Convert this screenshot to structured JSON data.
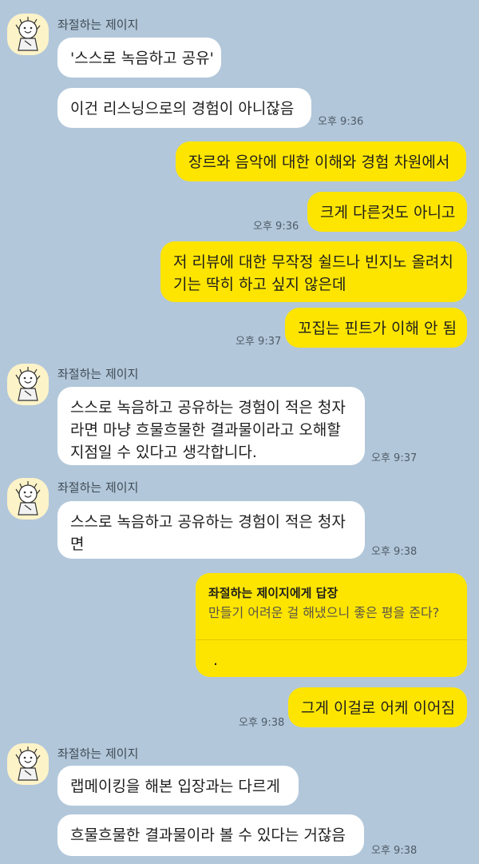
{
  "contact": {
    "name": "좌절하는 제이지"
  },
  "messages": {
    "m1": "'스스로 녹음하고 공유'",
    "m2": "이건 리스닝으로의 경험이 아니잖음",
    "t1": "오후 9:36",
    "m3": "장르와 음악에 대한 이해와 경험 차원에서",
    "m4": "크게 다른것도 아니고",
    "t2": "오후 9:36",
    "m5_l1": "저 리뷰에 대한 무작정 쉴드나 빈지노 올려치",
    "m5_l2": "기는 딱히 하고 싶지 않은데",
    "m6": "꼬집는 핀트가 이해 안 됨",
    "t3": "오후 9:37",
    "m7_l1": "스스로 녹음하고 공유하는 경험이 적은 청자",
    "m7_l2": "라면 마냥 흐물흐물한 결과물이라고 오해할",
    "m7_l3": "지점일 수 있다고 생각합니다.",
    "t4": "오후 9:37",
    "m8_l1": "스스로 녹음하고 공유하는 경험이 적은 청자",
    "m8_l2": "면",
    "t5": "오후 9:38",
    "reply": {
      "title": "좌절하는 제이지에게 답장",
      "quote": "만들기 어려운 걸 해냈으니 좋은 평을 준다?",
      "text": "."
    },
    "m9": "그게 이걸로 어케 이어짐",
    "t6": "오후 9:38",
    "m10": "랩메이킹을 해본 입장과는 다르게",
    "m11": "흐물흐물한 결과물이라 볼 수 있다는 거잖음",
    "t7": "오후 9:38"
  },
  "colors": {
    "background": "#b2c7da",
    "incoming_bubble": "#ffffff",
    "outgoing_bubble": "#fee500"
  },
  "icons": {
    "avatar": "cartoon-character-avatar"
  }
}
